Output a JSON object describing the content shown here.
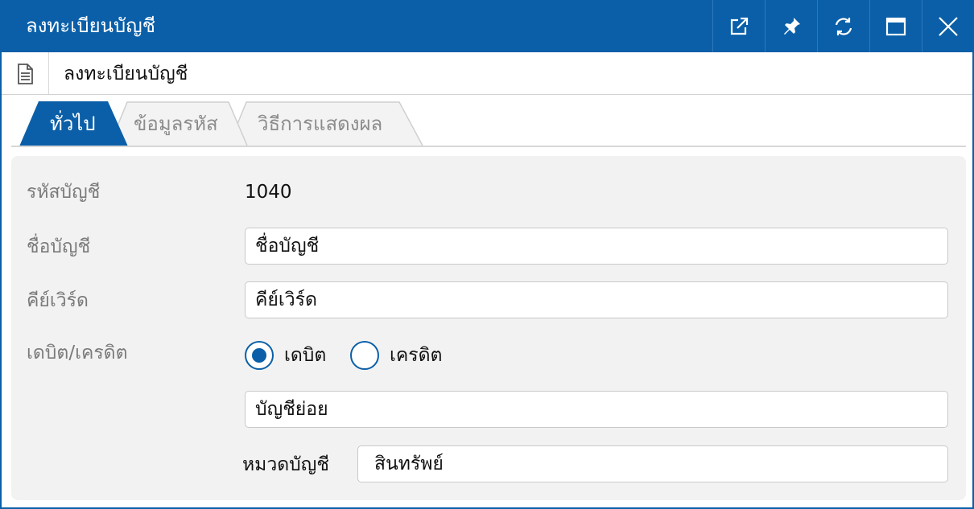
{
  "window": {
    "title": "ลงทะเบียนบัญชี",
    "buttons": [
      {
        "name": "open-external",
        "icon": "external-link-icon"
      },
      {
        "name": "pin",
        "icon": "pin-icon"
      },
      {
        "name": "refresh",
        "icon": "refresh-icon"
      },
      {
        "name": "maximize",
        "icon": "maximize-icon"
      },
      {
        "name": "close",
        "icon": "close-icon"
      }
    ]
  },
  "subheader": {
    "icon": "document-icon",
    "title": "ลงทะเบียนบัญชี"
  },
  "tabs": [
    {
      "label": "ทั่วไป",
      "active": true
    },
    {
      "label": "ข้อมูลรหัส",
      "active": false
    },
    {
      "label": "วิธีการแสดงผล",
      "active": false
    }
  ],
  "form": {
    "account_code": {
      "label": "รหัสบัญชี",
      "value": "1040"
    },
    "account_name": {
      "label": "ชื่อบัญชี",
      "value": "ชื่อบัญชี"
    },
    "keyword": {
      "label": "คีย์เวิร์ด",
      "value": "คีย์เวิร์ด"
    },
    "debit_credit": {
      "label": "เดบิต/เครดิต",
      "options": [
        {
          "label": "เดบิต",
          "checked": true
        },
        {
          "label": "เครดิต",
          "checked": false
        }
      ]
    },
    "sub_account": {
      "value": "บัญชีย่อย"
    },
    "category": {
      "label": "หมวดบัญชี",
      "value": "สินทรัพย์"
    }
  },
  "colors": {
    "accent": "#0a5fa8",
    "panel_bg": "#f2f2f2",
    "label_gray": "#7a7a7a"
  }
}
